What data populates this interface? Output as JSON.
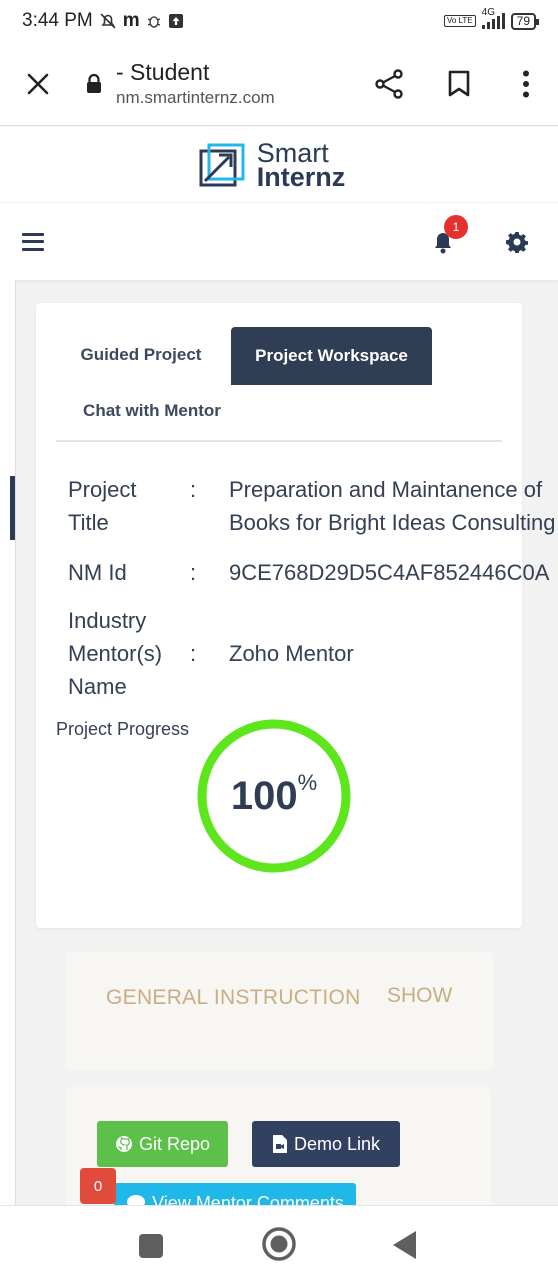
{
  "status_bar": {
    "time": "3:44 PM",
    "battery": "79",
    "network": "4G",
    "volte": "Vo LTE"
  },
  "browser": {
    "page_title": "- Student",
    "url": "nm.smartinternz.com"
  },
  "site": {
    "logo_line1": "Smart",
    "logo_line2": "Internz",
    "notification_count": "1"
  },
  "tabs": {
    "guided": "Guided Project",
    "workspace": "Project Workspace",
    "chat": "Chat with Mentor"
  },
  "project": {
    "title_label_1": "Project",
    "title_label_2": "Title",
    "title_value_1": "Preparation and Maintanence of",
    "title_value_2": "Books for Bright Ideas Consulting",
    "nm_label": "NM Id",
    "nm_value": "9CE768D29D5C4AF852446C0A",
    "mentor_label_1": "Industry",
    "mentor_label_2": "Mentor(s)",
    "mentor_label_3": "Name",
    "mentor_value": "Zoho Mentor",
    "colon": ":"
  },
  "progress": {
    "label": "Project Progress",
    "value": "100",
    "unit": "%",
    "fraction": 1.0,
    "color": "#5ee61c"
  },
  "instructions": {
    "title": "GENERAL INSTRUCTION",
    "toggle": "SHOW"
  },
  "links": {
    "git": "Git Repo",
    "demo": "Demo Link",
    "mentor_comments": "View Mentor Comments",
    "comment_count": "0"
  }
}
